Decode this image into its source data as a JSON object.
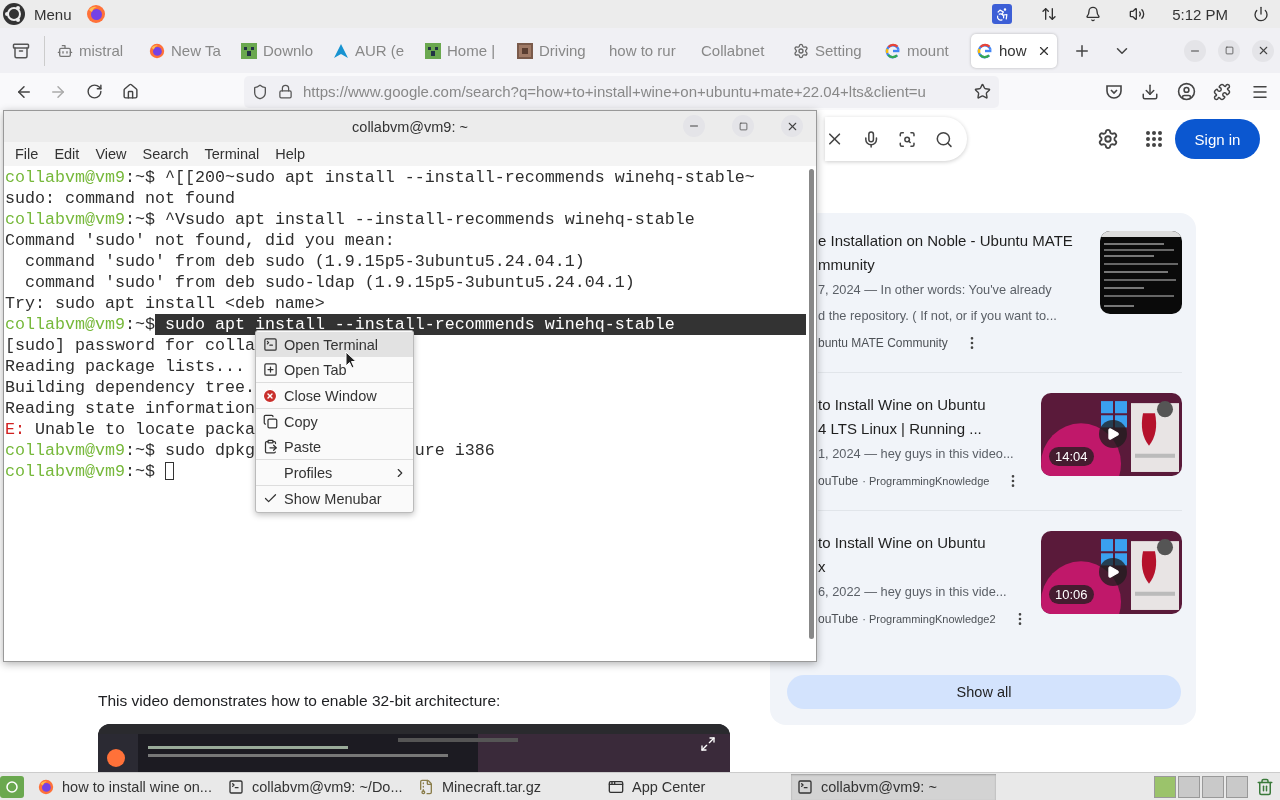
{
  "top_panel": {
    "menu_label": "Menu",
    "clock": "5:12 PM"
  },
  "browser": {
    "tabs": [
      {
        "label": "mistral",
        "kind": "robot",
        "selected": false
      },
      {
        "label": "New Ta",
        "kind": "firefox",
        "selected": false
      },
      {
        "label": "Downlo",
        "kind": "block",
        "selected": false
      },
      {
        "label": "AUR (e",
        "kind": "arch",
        "selected": false
      },
      {
        "label": "Home |",
        "kind": "block",
        "selected": false
      },
      {
        "label": "Driving",
        "kind": "brick",
        "selected": false
      },
      {
        "label": "how to rur",
        "kind": "none",
        "selected": false
      },
      {
        "label": "Collabnet",
        "kind": "none",
        "selected": false
      },
      {
        "label": "Setting",
        "kind": "gear",
        "selected": false
      },
      {
        "label": "mount",
        "kind": "google",
        "selected": false
      },
      {
        "label": "how",
        "kind": "google",
        "selected": true
      }
    ],
    "url": "https://www.google.com/search?q=how+to+install+wine+on+ubuntu+mate+22.04+lts&client=u",
    "sign_in": "Sign in",
    "results": [
      {
        "kind": "article",
        "title_lines": [
          "e Installation on Noble - Ubuntu MATE",
          "mmunity"
        ],
        "snippet_lines": [
          "7, 2024 — In other words: You've already",
          "d the repository. ( If not, or if you want to..."
        ],
        "source": "buntu MATE Community"
      },
      {
        "kind": "video",
        "title_lines": [
          "to Install Wine on Ubuntu",
          "4 LTS Linux | Running ..."
        ],
        "snippet_lines": [
          "1, 2024 — hey guys in this video..."
        ],
        "source": "ouTube",
        "channel": "· ProgrammingKnowledge",
        "duration": "14:04"
      },
      {
        "kind": "video",
        "title_lines": [
          "to Install Wine on Ubuntu",
          "x"
        ],
        "snippet_lines": [
          "6, 2022 — hey guys in this vide..."
        ],
        "source": "ouTube",
        "channel": "· ProgrammingKnowledge2",
        "duration": "10:06"
      }
    ],
    "show_all": "Show all",
    "article_text": "This video demonstrates how to enable 32-bit architecture:"
  },
  "terminal": {
    "title": "collabvm@vm9: ~",
    "menu": [
      "File",
      "Edit",
      "View",
      "Search",
      "Terminal",
      "Help"
    ],
    "lines": [
      {
        "segments": [
          {
            "kind": "prompt",
            "text": "collabvm@vm9"
          },
          {
            "kind": "plain",
            "text": ":~$ ^[[200~sudo apt install --install-recommends winehq-stable~"
          }
        ]
      },
      {
        "segments": [
          {
            "kind": "plain",
            "text": "sudo: command not found"
          }
        ]
      },
      {
        "segments": [
          {
            "kind": "prompt",
            "text": "collabvm@vm9"
          },
          {
            "kind": "plain",
            "text": ":~$ ^Vsudo apt install --install-recommends winehq-stable"
          }
        ]
      },
      {
        "segments": [
          {
            "kind": "plain",
            "text": "Command 'sudo' not found, did you mean:"
          }
        ]
      },
      {
        "segments": [
          {
            "kind": "plain",
            "text": "  command 'sudo' from deb sudo (1.9.15p5-3ubuntu5.24.04.1)"
          }
        ]
      },
      {
        "segments": [
          {
            "kind": "plain",
            "text": "  command 'sudo' from deb sudo-ldap (1.9.15p5-3ubuntu5.24.04.1)"
          }
        ]
      },
      {
        "segments": [
          {
            "kind": "plain",
            "text": "Try: sudo apt install <deb name>"
          }
        ]
      },
      {
        "segments": [
          {
            "kind": "prompt",
            "text": "collabvm@vm9"
          },
          {
            "kind": "plain",
            "text": ":~$"
          },
          {
            "kind": "selected",
            "text": " sudo apt install --install-recommends winehq-stable"
          }
        ]
      },
      {
        "segments": [
          {
            "kind": "plain",
            "text": "[sudo] password for colla"
          }
        ]
      },
      {
        "segments": [
          {
            "kind": "plain",
            "text": "Reading package lists..."
          }
        ]
      },
      {
        "segments": [
          {
            "kind": "plain",
            "text": "Building dependency tree."
          }
        ]
      },
      {
        "segments": [
          {
            "kind": "plain",
            "text": "Reading state information"
          }
        ]
      },
      {
        "segments": [
          {
            "kind": "error",
            "text": "E:"
          },
          {
            "kind": "plain",
            "text": " Unable to locate packa"
          }
        ]
      },
      {
        "segments": [
          {
            "kind": "prompt",
            "text": "collabvm@vm9"
          },
          {
            "kind": "plain",
            "text": ":~$ sudo dpkg"
          },
          {
            "kind": "after",
            "text": "ure i386"
          }
        ]
      },
      {
        "segments": [
          {
            "kind": "prompt",
            "text": "collabvm@vm9"
          },
          {
            "kind": "plain",
            "text": ":~$ "
          }
        ],
        "cursor": true
      }
    ],
    "context_menu": [
      {
        "kind": "terminal",
        "label": "Open Terminal",
        "selected": true
      },
      {
        "kind": "tab",
        "label": "Open Tab",
        "selected": false
      },
      {
        "kind": "separator"
      },
      {
        "kind": "close",
        "label": "Close Window",
        "selected": false
      },
      {
        "kind": "separator"
      },
      {
        "kind": "copy",
        "label": "Copy",
        "selected": false
      },
      {
        "kind": "paste",
        "label": "Paste",
        "selected": false
      },
      {
        "kind": "separator"
      },
      {
        "kind": "submenu",
        "label": "Profiles",
        "selected": false
      },
      {
        "kind": "separator"
      },
      {
        "kind": "toggle",
        "label": "Show Menubar",
        "selected": false,
        "checked": true
      }
    ]
  },
  "taskbar": {
    "items": [
      {
        "kind": "firefox",
        "label": "how to install wine on...",
        "selected": false
      },
      {
        "kind": "terminal",
        "label": "collabvm@vm9: ~/Do...",
        "selected": false
      },
      {
        "kind": "archive",
        "label": "Minecraft.tar.gz",
        "selected": false
      },
      {
        "kind": "window",
        "label": "App Center",
        "selected": false
      },
      {
        "kind": "terminal",
        "label": "collabvm@vm9: ~",
        "selected": true
      }
    ]
  }
}
